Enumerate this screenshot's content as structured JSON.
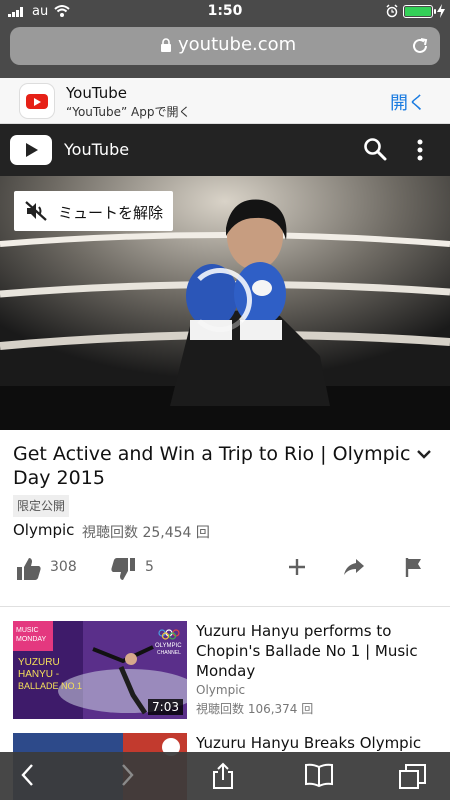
{
  "status_bar": {
    "carrier": "au",
    "time": "1:50",
    "battery_level": 1.0
  },
  "browser": {
    "url": "youtube.com"
  },
  "app_banner": {
    "app_name": "YouTube",
    "subtitle": "“YouTube” Appで開く",
    "open_label": "開く"
  },
  "yt_header": {
    "title": "YouTube"
  },
  "player": {
    "mute_label": "ミュートを解除"
  },
  "video": {
    "title": "Get Active and Win a Trip to Rio | Olympic Day 2015",
    "visibility": "限定公開",
    "channel": "Olympic",
    "views": "視聴回数 25,454 回",
    "likes": "308",
    "dislikes": "5"
  },
  "related": [
    {
      "title": "Yuzuru Hanyu performs to Chopin's Ballade No 1 | Music Monday",
      "channel": "Olympic",
      "views": "視聴回数 106,374 回",
      "duration": "7:03",
      "thumb_text": [
        "MUSIC",
        "MONDAY",
        "YUZURU",
        "HANYU -",
        "BALLADE NO.1",
        "OLYMPIC",
        "CHANNEL"
      ]
    },
    {
      "title": "Yuzuru Hanyu Breaks Olympic"
    }
  ],
  "colors": {
    "youtube_red": "#e62117",
    "link_blue": "#1a7be0",
    "battery_green": "#34d058"
  }
}
